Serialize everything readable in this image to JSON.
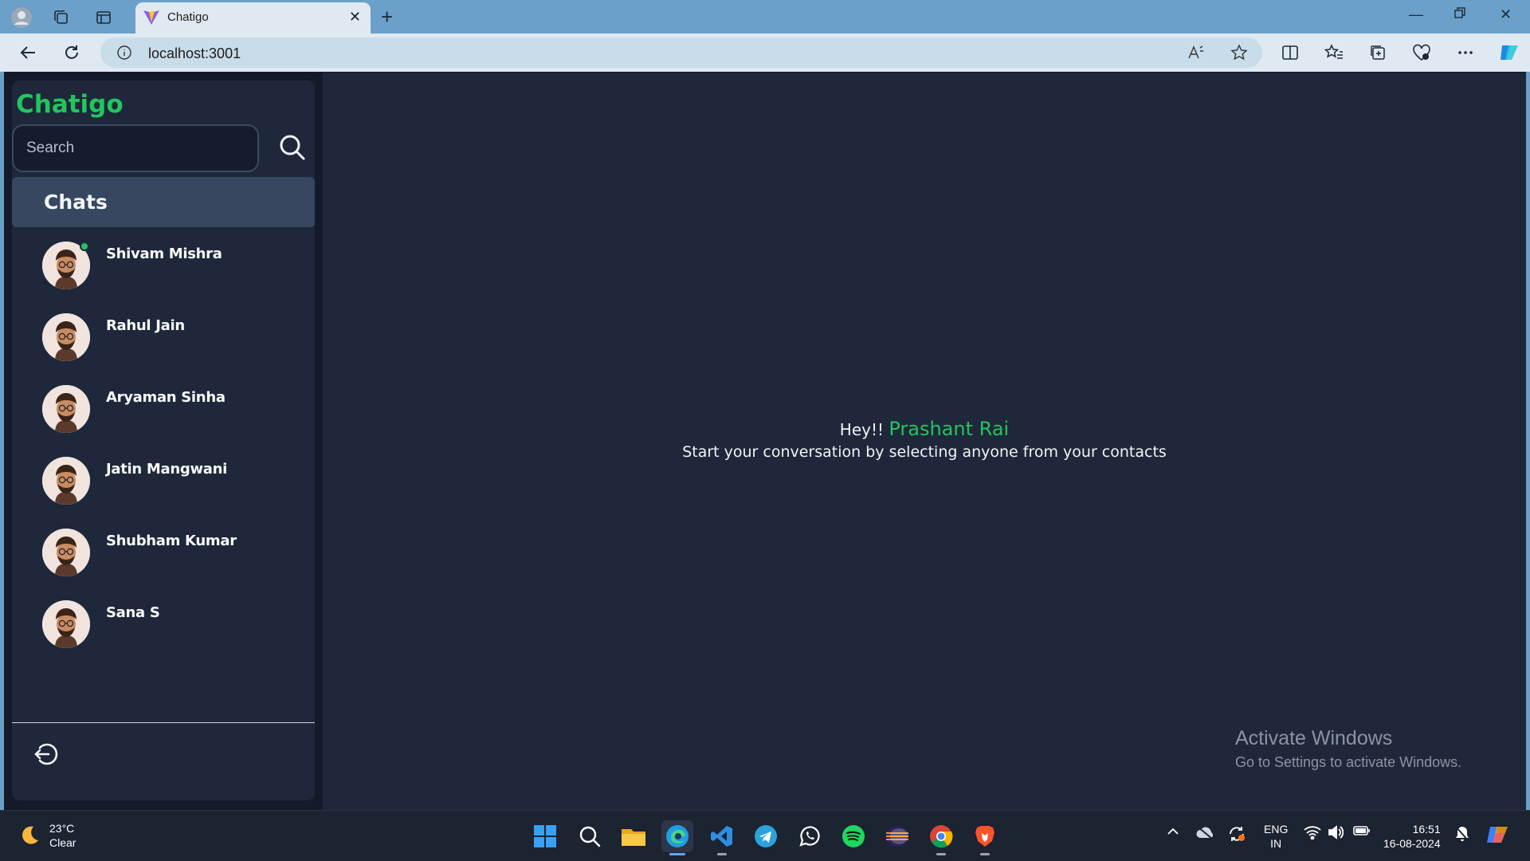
{
  "browser": {
    "tab_title": "Chatigo",
    "address": "localhost:3001"
  },
  "app": {
    "brand": "Chatigo",
    "search": {
      "placeholder": "Search"
    },
    "chats_header": "Chats",
    "contacts": [
      {
        "name": "Shivam Mishra",
        "online": true
      },
      {
        "name": "Rahul Jain",
        "online": false
      },
      {
        "name": "Aryaman Sinha",
        "online": false
      },
      {
        "name": "Jatin Mangwani",
        "online": false
      },
      {
        "name": "Shubham Kumar",
        "online": false
      },
      {
        "name": "Sana S",
        "online": false
      }
    ],
    "greeting": {
      "hey": "Hey!!",
      "user_name": "Prashant Rai",
      "subtitle": "Start your conversation by selecting anyone from your contacts"
    },
    "accent_color": "#22c55e"
  },
  "watermark": {
    "title": "Activate Windows",
    "subtitle": "Go to Settings to activate Windows."
  },
  "taskbar": {
    "weather_temp": "23°C",
    "weather_desc": "Clear",
    "lang_1": "ENG",
    "lang_2": "IN",
    "time": "16:51",
    "date": "16-08-2024",
    "apps": [
      "windows-start-icon",
      "search-icon",
      "file-explorer-icon",
      "edge-icon",
      "vscode-icon",
      "telegram-icon",
      "whatsapp-icon",
      "spotify-icon",
      "eclipse-icon",
      "chrome-icon",
      "brave-icon"
    ]
  }
}
